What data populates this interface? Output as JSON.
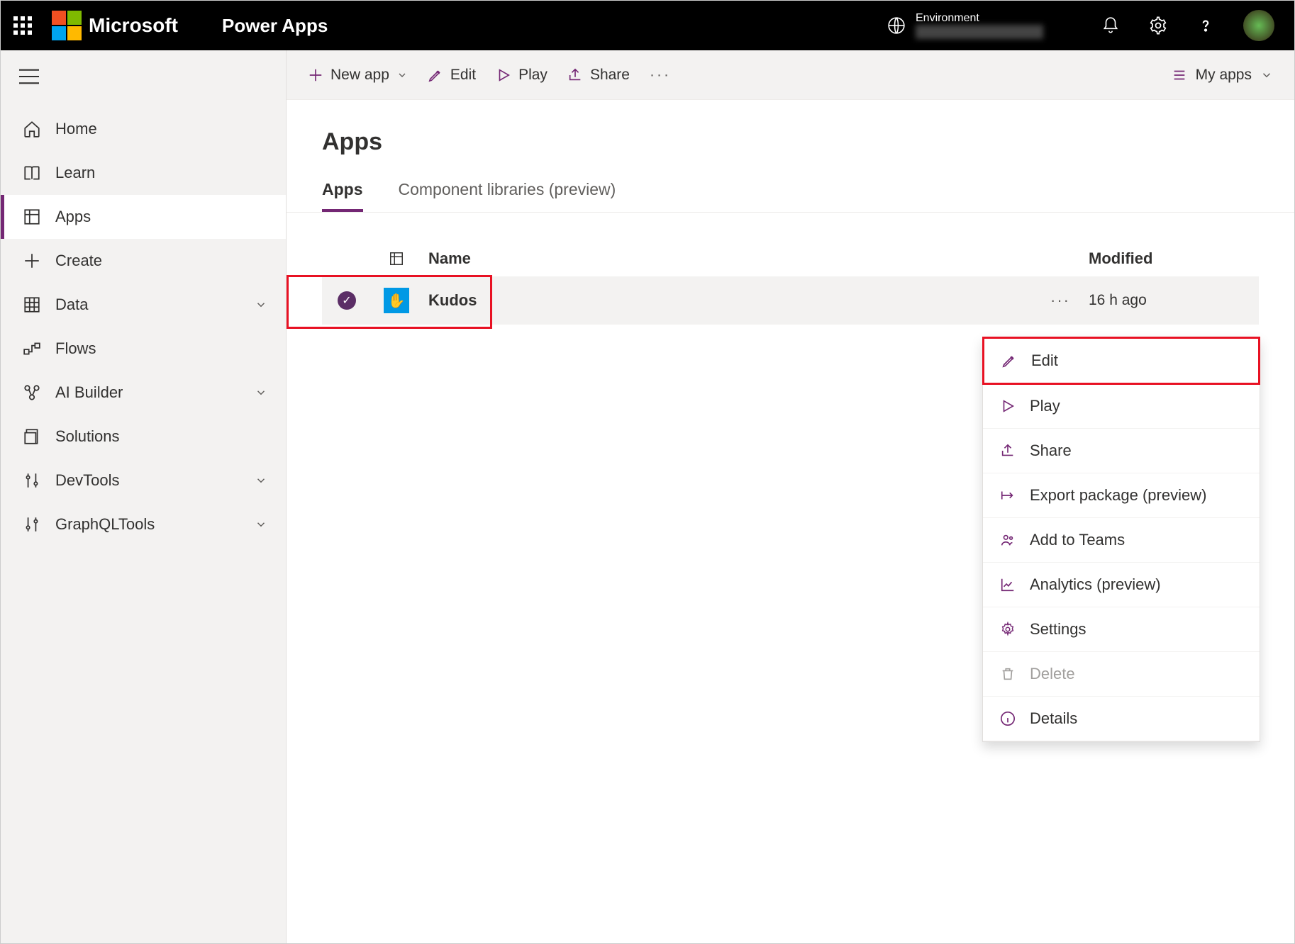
{
  "header": {
    "brand": "Microsoft",
    "product": "Power Apps",
    "env_label": "Environment"
  },
  "sidebar": {
    "items": [
      {
        "label": "Home"
      },
      {
        "label": "Learn"
      },
      {
        "label": "Apps"
      },
      {
        "label": "Create"
      },
      {
        "label": "Data"
      },
      {
        "label": "Flows"
      },
      {
        "label": "AI Builder"
      },
      {
        "label": "Solutions"
      },
      {
        "label": "DevTools"
      },
      {
        "label": "GraphQLTools"
      }
    ]
  },
  "cmdbar": {
    "new_app": "New app",
    "edit": "Edit",
    "play": "Play",
    "share": "Share",
    "view": "My apps"
  },
  "page": {
    "title": "Apps"
  },
  "tabs": {
    "t1": "Apps",
    "t2": "Component libraries (preview)"
  },
  "table": {
    "col_name": "Name",
    "col_modified": "Modified",
    "rows": [
      {
        "name": "Kudos",
        "modified": "16 h ago"
      }
    ]
  },
  "ctx": {
    "edit": "Edit",
    "play": "Play",
    "share": "Share",
    "export": "Export package (preview)",
    "teams": "Add to Teams",
    "analytics": "Analytics (preview)",
    "settings": "Settings",
    "delete": "Delete",
    "details": "Details"
  }
}
